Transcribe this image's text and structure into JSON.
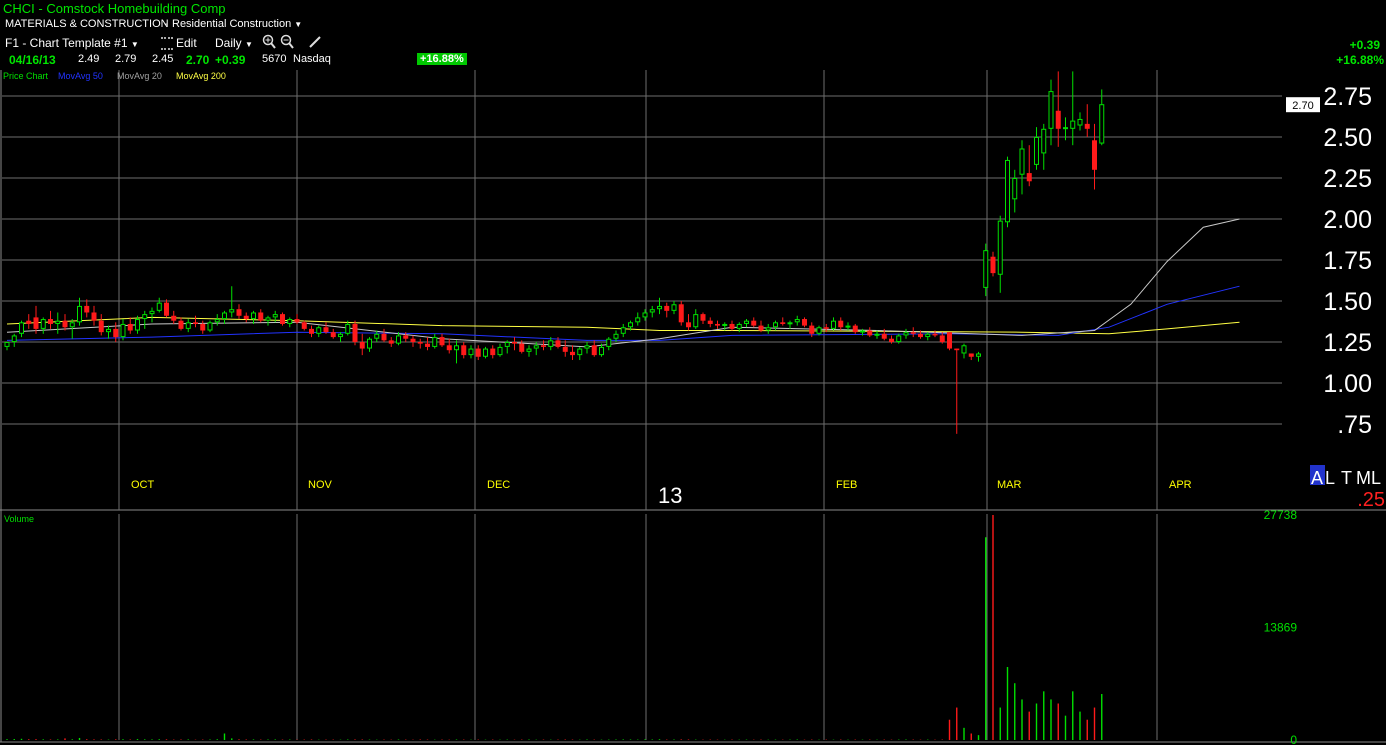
{
  "header": {
    "title": "CHCI - Comstock Homebuilding Comp",
    "sector": "MATERIALS & CONSTRUCTION",
    "industry": "Residential Construction",
    "template": "F1 - Chart Template #1",
    "edit_label": "Edit",
    "period": "Daily",
    "date": "04/16/13",
    "open": "2.49",
    "high": "2.79",
    "low": "2.45",
    "close": "2.70",
    "change": "+0.39",
    "volume": "5670",
    "exchange": "Nasdaq",
    "pct_badge": "+16.88%",
    "right_change": "+0.39",
    "right_pct": "+16.88%"
  },
  "legend": {
    "price_chart": "Price Chart",
    "ma50": "MovAvg 50",
    "ma20": "MovAvg 20",
    "ma200": "MovAvg 200"
  },
  "colors": {
    "up": "#00e000",
    "down": "#ff1a1a",
    "ma50": "#2233ff",
    "ma20": "#c8c8c8",
    "ma200": "#ffff44",
    "grid": "#6e6e6e",
    "month_label": "#ffff00",
    "badge_bg": "#00c800"
  },
  "icons": [
    "zoom-in-icon",
    "zoom-out-icon",
    "draw-line-icon",
    "dropdown-arrow-icon"
  ],
  "price_axis": {
    "ticks": [
      {
        "value": 2.75,
        "label": "2.75"
      },
      {
        "value": 2.5,
        "label": "2.50"
      },
      {
        "value": 2.25,
        "label": "2.25"
      },
      {
        "value": 2.0,
        "label": "2.00"
      },
      {
        "value": 1.75,
        "label": "1.75"
      },
      {
        "value": 1.5,
        "label": "1.50"
      },
      {
        "value": 1.25,
        "label": "1.25"
      },
      {
        "value": 1.0,
        "label": "1.00"
      },
      {
        "value": 0.75,
        "label": ".75"
      }
    ],
    "current_label": "2.70",
    "scale_letters": [
      "A",
      "L",
      "T",
      "M",
      "L"
    ],
    "scale_value": ".25"
  },
  "months": [
    "OCT",
    "NOV",
    "DEC",
    "13",
    "FEB",
    "MAR",
    "APR"
  ],
  "volume_pane": {
    "label": "Volume",
    "ticks": [
      {
        "value": 27738,
        "label": "27738"
      },
      {
        "value": 13869,
        "label": "13869"
      },
      {
        "value": 0,
        "label": "0"
      }
    ]
  },
  "chart_data": {
    "type": "candlestick",
    "title": "CHCI - Comstock Homebuilding Comp",
    "ylim": [
      0.62,
      2.9
    ],
    "volume_max": 27738,
    "candles": [
      [
        1.22,
        1.25,
        1.2,
        1.25,
        100
      ],
      [
        1.25,
        1.3,
        1.22,
        1.29,
        120
      ],
      [
        1.3,
        1.38,
        1.28,
        1.37,
        150
      ],
      [
        1.38,
        1.42,
        1.33,
        1.36,
        90
      ],
      [
        1.4,
        1.47,
        1.3,
        1.33,
        100
      ],
      [
        1.33,
        1.4,
        1.3,
        1.39,
        80
      ],
      [
        1.39,
        1.44,
        1.33,
        1.36,
        60
      ],
      [
        1.36,
        1.43,
        1.3,
        1.38,
        70
      ],
      [
        1.38,
        1.42,
        1.32,
        1.34,
        200
      ],
      [
        1.34,
        1.39,
        1.27,
        1.37,
        80
      ],
      [
        1.37,
        1.52,
        1.35,
        1.47,
        250
      ],
      [
        1.47,
        1.51,
        1.4,
        1.43,
        90
      ],
      [
        1.43,
        1.47,
        1.35,
        1.38,
        70
      ],
      [
        1.38,
        1.42,
        1.29,
        1.31,
        60
      ],
      [
        1.31,
        1.35,
        1.27,
        1.33,
        50
      ],
      [
        1.33,
        1.37,
        1.25,
        1.28,
        80
      ],
      [
        1.28,
        1.39,
        1.26,
        1.36,
        90
      ],
      [
        1.36,
        1.4,
        1.3,
        1.32,
        60
      ],
      [
        1.32,
        1.41,
        1.3,
        1.39,
        110
      ],
      [
        1.39,
        1.44,
        1.33,
        1.42,
        80
      ],
      [
        1.42,
        1.46,
        1.37,
        1.44,
        70
      ],
      [
        1.44,
        1.52,
        1.43,
        1.49,
        90
      ],
      [
        1.49,
        1.51,
        1.4,
        1.41,
        80
      ],
      [
        1.41,
        1.44,
        1.36,
        1.38,
        50
      ],
      [
        1.38,
        1.4,
        1.32,
        1.33,
        60
      ],
      [
        1.33,
        1.39,
        1.31,
        1.37,
        70
      ],
      [
        1.37,
        1.41,
        1.34,
        1.36,
        40
      ],
      [
        1.36,
        1.38,
        1.3,
        1.32,
        50
      ],
      [
        1.32,
        1.38,
        1.31,
        1.37,
        60
      ],
      [
        1.37,
        1.42,
        1.35,
        1.39,
        90
      ],
      [
        1.39,
        1.44,
        1.36,
        1.43,
        800
      ],
      [
        1.43,
        1.59,
        1.4,
        1.45,
        200
      ],
      [
        1.45,
        1.48,
        1.39,
        1.41,
        80
      ],
      [
        1.41,
        1.43,
        1.37,
        1.39,
        60
      ],
      [
        1.39,
        1.44,
        1.36,
        1.43,
        70
      ],
      [
        1.43,
        1.45,
        1.37,
        1.38,
        50
      ],
      [
        1.38,
        1.41,
        1.35,
        1.4,
        60
      ],
      [
        1.4,
        1.44,
        1.37,
        1.42,
        70
      ],
      [
        1.42,
        1.43,
        1.35,
        1.36,
        50
      ],
      [
        1.36,
        1.4,
        1.34,
        1.39,
        60
      ],
      [
        1.39,
        1.42,
        1.36,
        1.37,
        40
      ],
      [
        1.37,
        1.38,
        1.32,
        1.33,
        50
      ],
      [
        1.33,
        1.35,
        1.28,
        1.3,
        60
      ],
      [
        1.3,
        1.35,
        1.28,
        1.34,
        40
      ],
      [
        1.34,
        1.37,
        1.3,
        1.31,
        50
      ],
      [
        1.31,
        1.33,
        1.27,
        1.28,
        50
      ],
      [
        1.28,
        1.31,
        1.25,
        1.3,
        40
      ],
      [
        1.3,
        1.38,
        1.29,
        1.36,
        60
      ],
      [
        1.36,
        1.38,
        1.23,
        1.25,
        70
      ],
      [
        1.25,
        1.3,
        1.17,
        1.21,
        60
      ],
      [
        1.21,
        1.28,
        1.19,
        1.27,
        50
      ],
      [
        1.27,
        1.32,
        1.25,
        1.3,
        40
      ],
      [
        1.3,
        1.33,
        1.25,
        1.26,
        50
      ],
      [
        1.26,
        1.28,
        1.22,
        1.24,
        40
      ],
      [
        1.24,
        1.31,
        1.23,
        1.29,
        60
      ],
      [
        1.29,
        1.31,
        1.25,
        1.27,
        50
      ],
      [
        1.27,
        1.29,
        1.22,
        1.25,
        40
      ],
      [
        1.25,
        1.27,
        1.21,
        1.24,
        60
      ],
      [
        1.24,
        1.28,
        1.2,
        1.22,
        50
      ],
      [
        1.22,
        1.3,
        1.21,
        1.28,
        40
      ],
      [
        1.28,
        1.3,
        1.22,
        1.23,
        50
      ],
      [
        1.23,
        1.27,
        1.18,
        1.2,
        40
      ],
      [
        1.2,
        1.26,
        1.12,
        1.23,
        60
      ],
      [
        1.23,
        1.25,
        1.15,
        1.17,
        50
      ],
      [
        1.17,
        1.23,
        1.15,
        1.21,
        40
      ],
      [
        1.21,
        1.23,
        1.14,
        1.16,
        50
      ],
      [
        1.16,
        1.22,
        1.15,
        1.21,
        40
      ],
      [
        1.21,
        1.23,
        1.15,
        1.17,
        50
      ],
      [
        1.17,
        1.24,
        1.16,
        1.22,
        40
      ],
      [
        1.22,
        1.26,
        1.18,
        1.25,
        50
      ],
      [
        1.25,
        1.28,
        1.2,
        1.24,
        40
      ],
      [
        1.24,
        1.26,
        1.18,
        1.19,
        50
      ],
      [
        1.19,
        1.23,
        1.16,
        1.21,
        60
      ],
      [
        1.21,
        1.25,
        1.17,
        1.23,
        40
      ],
      [
        1.23,
        1.26,
        1.2,
        1.22,
        50
      ],
      [
        1.22,
        1.28,
        1.2,
        1.26,
        40
      ],
      [
        1.26,
        1.28,
        1.21,
        1.22,
        50
      ],
      [
        1.22,
        1.26,
        1.16,
        1.19,
        60
      ],
      [
        1.19,
        1.23,
        1.14,
        1.17,
        50
      ],
      [
        1.17,
        1.22,
        1.14,
        1.21,
        40
      ],
      [
        1.21,
        1.25,
        1.18,
        1.23,
        60
      ],
      [
        1.23,
        1.26,
        1.16,
        1.17,
        50
      ],
      [
        1.17,
        1.24,
        1.16,
        1.22,
        40
      ],
      [
        1.22,
        1.28,
        1.2,
        1.27,
        50
      ],
      [
        1.27,
        1.32,
        1.25,
        1.3,
        60
      ],
      [
        1.3,
        1.36,
        1.28,
        1.34,
        70
      ],
      [
        1.34,
        1.38,
        1.32,
        1.37,
        60
      ],
      [
        1.37,
        1.43,
        1.35,
        1.4,
        50
      ],
      [
        1.4,
        1.45,
        1.38,
        1.43,
        80
      ],
      [
        1.43,
        1.47,
        1.4,
        1.45,
        60
      ],
      [
        1.45,
        1.52,
        1.42,
        1.47,
        90
      ],
      [
        1.47,
        1.49,
        1.4,
        1.44,
        50
      ],
      [
        1.44,
        1.5,
        1.42,
        1.48,
        60
      ],
      [
        1.48,
        1.5,
        1.35,
        1.37,
        70
      ],
      [
        1.37,
        1.42,
        1.32,
        1.34,
        60
      ],
      [
        1.34,
        1.45,
        1.33,
        1.42,
        50
      ],
      [
        1.42,
        1.43,
        1.36,
        1.38,
        40
      ],
      [
        1.38,
        1.4,
        1.34,
        1.36,
        50
      ],
      [
        1.36,
        1.38,
        1.33,
        1.35,
        40
      ],
      [
        1.35,
        1.37,
        1.32,
        1.36,
        40
      ],
      [
        1.36,
        1.38,
        1.32,
        1.33,
        50
      ],
      [
        1.33,
        1.37,
        1.31,
        1.36,
        40
      ],
      [
        1.36,
        1.39,
        1.34,
        1.38,
        50
      ],
      [
        1.38,
        1.4,
        1.34,
        1.35,
        40
      ],
      [
        1.35,
        1.38,
        1.31,
        1.32,
        50
      ],
      [
        1.32,
        1.36,
        1.3,
        1.34,
        40
      ],
      [
        1.34,
        1.38,
        1.32,
        1.37,
        50
      ],
      [
        1.37,
        1.4,
        1.35,
        1.36,
        40
      ],
      [
        1.36,
        1.38,
        1.33,
        1.37,
        50
      ],
      [
        1.37,
        1.41,
        1.35,
        1.39,
        60
      ],
      [
        1.39,
        1.4,
        1.34,
        1.35,
        40
      ],
      [
        1.35,
        1.37,
        1.28,
        1.3,
        50
      ],
      [
        1.3,
        1.35,
        1.29,
        1.34,
        40
      ],
      [
        1.34,
        1.36,
        1.31,
        1.33,
        50
      ],
      [
        1.33,
        1.4,
        1.32,
        1.38,
        40
      ],
      [
        1.38,
        1.4,
        1.32,
        1.34,
        50
      ],
      [
        1.34,
        1.37,
        1.32,
        1.35,
        40
      ],
      [
        1.35,
        1.36,
        1.3,
        1.31,
        50
      ],
      [
        1.31,
        1.33,
        1.29,
        1.32,
        40
      ],
      [
        1.32,
        1.34,
        1.28,
        1.29,
        50
      ],
      [
        1.29,
        1.32,
        1.27,
        1.3,
        40
      ],
      [
        1.3,
        1.33,
        1.26,
        1.27,
        50
      ],
      [
        1.27,
        1.29,
        1.24,
        1.25,
        40
      ],
      [
        1.25,
        1.3,
        1.24,
        1.29,
        50
      ],
      [
        1.29,
        1.33,
        1.27,
        1.31,
        60
      ],
      [
        1.31,
        1.34,
        1.28,
        1.3,
        50
      ],
      [
        1.3,
        1.32,
        1.27,
        1.28,
        40
      ],
      [
        1.28,
        1.31,
        1.26,
        1.3,
        50
      ],
      [
        1.3,
        1.32,
        1.28,
        1.29,
        40
      ],
      [
        1.29,
        1.31,
        1.24,
        1.25,
        50
      ],
      [
        1.31,
        1.31,
        1.2,
        1.21,
        2500
      ],
      [
        1.21,
        1.21,
        0.69,
        1.2,
        4000
      ],
      [
        1.18,
        1.24,
        1.15,
        1.23,
        1500
      ],
      [
        1.18,
        1.18,
        1.14,
        1.16,
        800
      ],
      [
        1.16,
        1.19,
        1.13,
        1.18,
        600
      ],
      [
        1.58,
        1.85,
        1.53,
        1.81,
        25000
      ],
      [
        1.77,
        1.8,
        1.65,
        1.67,
        27738
      ],
      [
        1.66,
        2.02,
        1.55,
        1.99,
        4000
      ],
      [
        1.98,
        2.38,
        1.95,
        2.36,
        9000
      ],
      [
        2.12,
        2.3,
        2.04,
        2.25,
        7000
      ],
      [
        2.27,
        2.48,
        2.15,
        2.43,
        5000
      ],
      [
        2.28,
        2.45,
        2.2,
        2.23,
        3500
      ],
      [
        2.33,
        2.56,
        2.3,
        2.5,
        4500
      ],
      [
        2.4,
        2.58,
        2.3,
        2.55,
        6000
      ],
      [
        2.55,
        2.85,
        2.45,
        2.78,
        5000
      ],
      [
        2.66,
        2.9,
        2.44,
        2.55,
        4500
      ],
      [
        2.55,
        2.62,
        2.48,
        2.56,
        3000
      ],
      [
        2.55,
        2.9,
        2.45,
        2.6,
        6000
      ],
      [
        2.57,
        2.65,
        2.54,
        2.61,
        3500
      ],
      [
        2.58,
        2.7,
        2.5,
        2.55,
        2500
      ],
      [
        2.48,
        2.58,
        2.18,
        2.3,
        4000
      ],
      [
        2.46,
        2.79,
        2.45,
        2.7,
        5670
      ]
    ],
    "ma20": [
      [
        0,
        1.31
      ],
      [
        20,
        1.36
      ],
      [
        40,
        1.37
      ],
      [
        60,
        1.27
      ],
      [
        80,
        1.22
      ],
      [
        90,
        1.27
      ],
      [
        100,
        1.34
      ],
      [
        120,
        1.32
      ],
      [
        140,
        1.29
      ],
      [
        150,
        1.32
      ],
      [
        155,
        1.48
      ],
      [
        160,
        1.74
      ],
      [
        165,
        1.95
      ],
      [
        170,
        2.0
      ]
    ],
    "ma50": [
      [
        0,
        1.26
      ],
      [
        20,
        1.28
      ],
      [
        40,
        1.31
      ],
      [
        60,
        1.3
      ],
      [
        80,
        1.26
      ],
      [
        90,
        1.26
      ],
      [
        100,
        1.29
      ],
      [
        130,
        1.3
      ],
      [
        145,
        1.29
      ],
      [
        152,
        1.34
      ],
      [
        160,
        1.48
      ],
      [
        170,
        1.59
      ]
    ],
    "ma200": [
      [
        0,
        1.36
      ],
      [
        20,
        1.4
      ],
      [
        40,
        1.38
      ],
      [
        60,
        1.35
      ],
      [
        80,
        1.34
      ],
      [
        90,
        1.32
      ],
      [
        100,
        1.32
      ],
      [
        140,
        1.31
      ],
      [
        152,
        1.3
      ],
      [
        160,
        1.33
      ],
      [
        170,
        1.37
      ]
    ]
  }
}
